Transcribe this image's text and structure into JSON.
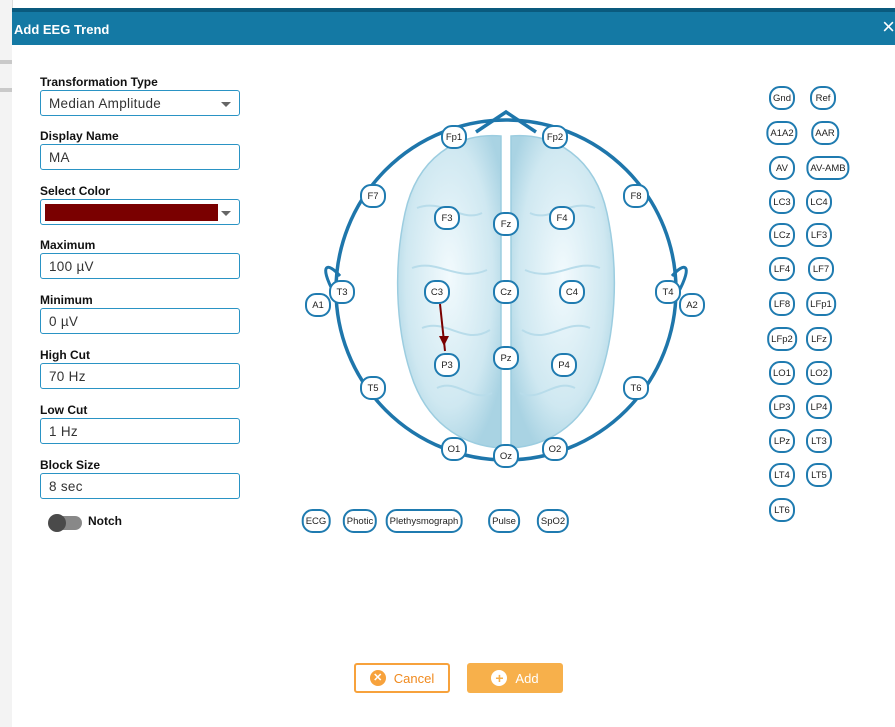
{
  "dialog": {
    "title": "Add EEG Trend",
    "close_icon": "×"
  },
  "form": {
    "transformation_type": {
      "label": "Transformation Type",
      "value": "Median Amplitude"
    },
    "display_name": {
      "label": "Display Name",
      "value": "MA"
    },
    "select_color": {
      "label": "Select Color",
      "value": "#7a0000"
    },
    "maximum": {
      "label": "Maximum",
      "value": "100 µV"
    },
    "minimum": {
      "label": "Minimum",
      "value": "0 µV"
    },
    "high_cut": {
      "label": "High Cut",
      "value": "70 Hz"
    },
    "low_cut": {
      "label": "Low Cut",
      "value": "1 Hz"
    },
    "block_size": {
      "label": "Block Size",
      "value": "8 sec"
    },
    "notch": {
      "label": "Notch",
      "on": false
    }
  },
  "head_electrodes": [
    "Fp1",
    "Fp2",
    "F7",
    "F8",
    "F3",
    "Fz",
    "F4",
    "A1",
    "T3",
    "C3",
    "Cz",
    "C4",
    "T4",
    "A2",
    "P3",
    "Pz",
    "P4",
    "T5",
    "T6",
    "O1",
    "Oz",
    "O2"
  ],
  "selected_link": {
    "from": "C3",
    "to": "P3",
    "color": "#7a0000"
  },
  "aux_channels": [
    "ECG",
    "Photic",
    "Plethysmograph",
    "Pulse",
    "SpO2"
  ],
  "reference_channels": [
    "Gnd",
    "Ref",
    "A1A2",
    "AAR",
    "AV",
    "AV-AMB",
    "LC3",
    "LC4",
    "LCz",
    "LF3",
    "LF4",
    "LF7",
    "LF8",
    "LFp1",
    "LFp2",
    "LFz",
    "LO1",
    "LO2",
    "LP3",
    "LP4",
    "LPz",
    "LT3",
    "LT4",
    "LT5",
    "LT6"
  ],
  "buttons": {
    "cancel": "Cancel",
    "add": "Add"
  },
  "colors": {
    "header": "#1479a4",
    "electrode_border": "#1f7bb0",
    "accent": "#f7a23c"
  }
}
